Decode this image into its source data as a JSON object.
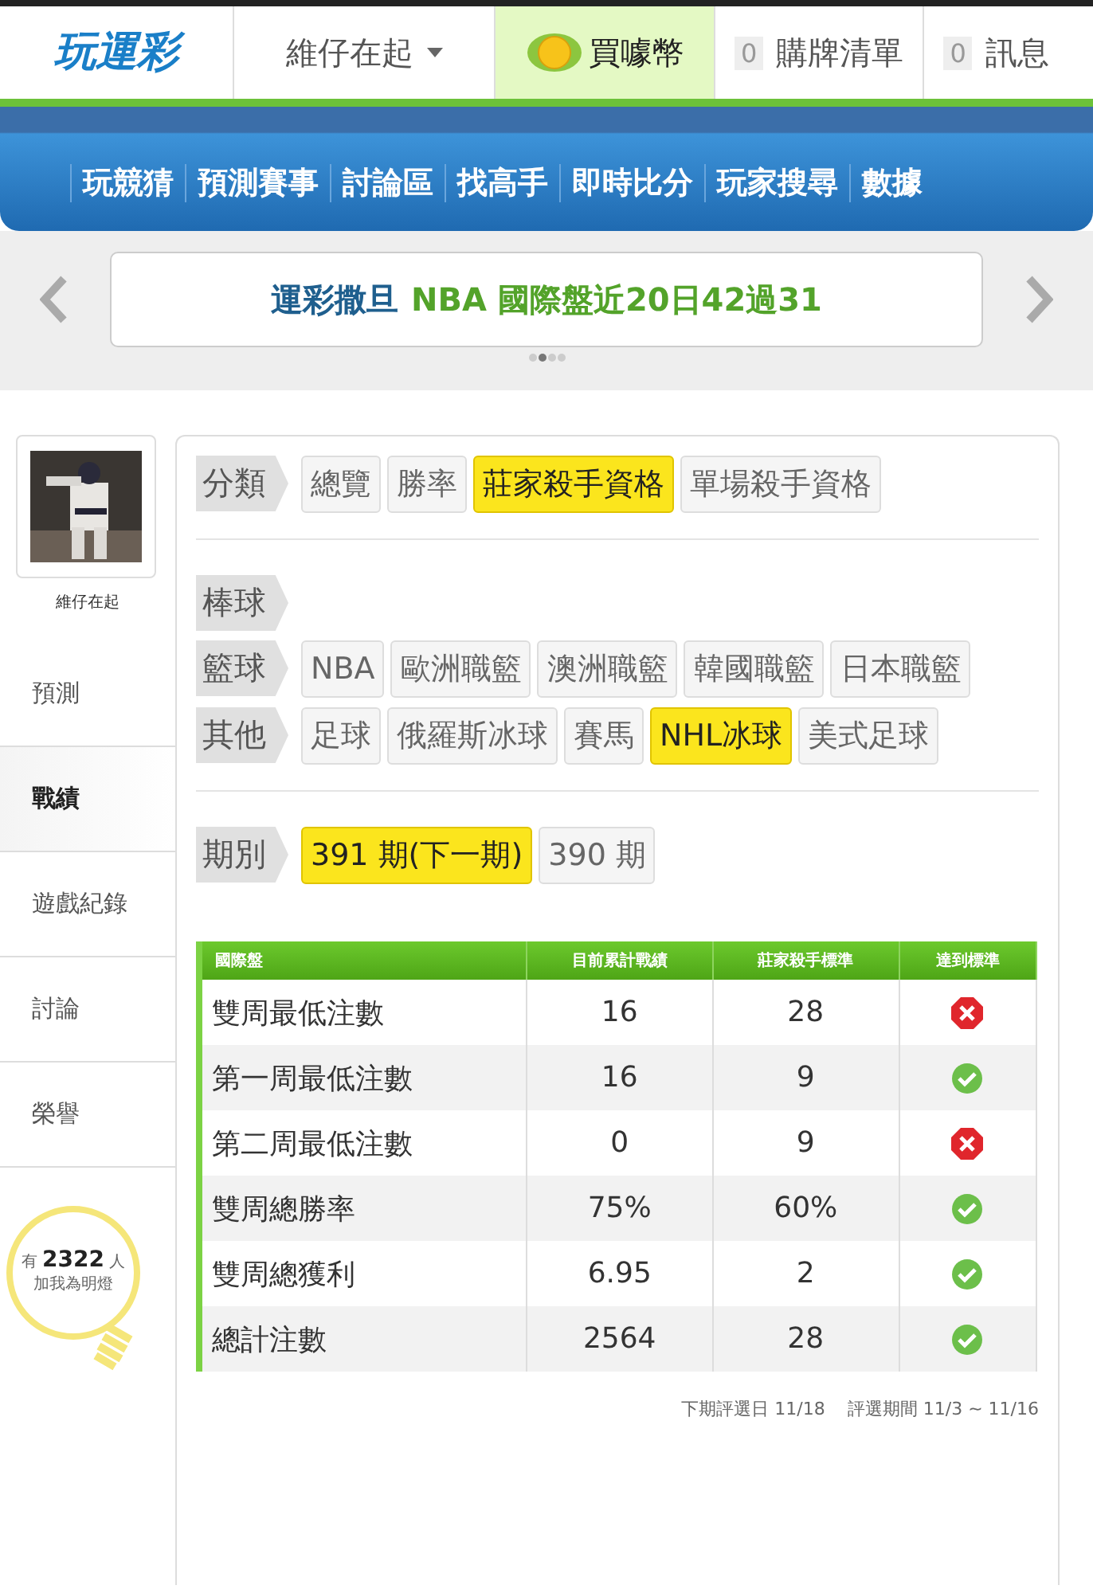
{
  "header": {
    "logo": "玩運彩",
    "user_menu": "維仔在起",
    "buy_coins": "買噱幣",
    "cart": {
      "count": "0",
      "label": "購牌清單"
    },
    "messages": {
      "count": "0",
      "label": "訊息"
    }
  },
  "nav": [
    "玩競猜",
    "預測賽事",
    "討論區",
    "找高手",
    "即時比分",
    "玩家搜尋",
    "數據"
  ],
  "banner": {
    "author": "運彩撒旦",
    "headline": "NBA 國際盤近20日42過31",
    "dots": [
      {
        "selected": false
      },
      {
        "selected": true
      },
      {
        "selected": false
      },
      {
        "selected": false
      }
    ]
  },
  "sidebar": {
    "username": "維仔在起",
    "items": [
      {
        "label": "預測",
        "selected": false
      },
      {
        "label": "戰績",
        "selected": true
      },
      {
        "label": "遊戲紀錄",
        "selected": false
      },
      {
        "label": "討論",
        "selected": false
      },
      {
        "label": "榮譽",
        "selected": false
      }
    ],
    "fans": {
      "prefix": "有",
      "count": "2322",
      "suffix": "人",
      "caption": "加我為明燈"
    }
  },
  "filters": [
    {
      "label": "分類",
      "options": [
        {
          "label": "總覽",
          "selected": false
        },
        {
          "label": "勝率",
          "selected": false
        },
        {
          "label": "莊家殺手資格",
          "selected": true
        },
        {
          "label": "單場殺手資格",
          "selected": false
        }
      ]
    },
    {
      "label": "棒球"
    },
    {
      "label": "籃球",
      "options": [
        {
          "label": "NBA",
          "selected": false
        },
        {
          "label": "歐洲職籃",
          "selected": false
        },
        {
          "label": "澳洲職籃",
          "selected": false
        },
        {
          "label": "韓國職籃",
          "selected": false
        },
        {
          "label": "日本職籃",
          "selected": false
        }
      ]
    },
    {
      "label": "其他",
      "options": [
        {
          "label": "足球",
          "selected": false
        },
        {
          "label": "俄羅斯冰球",
          "selected": false
        },
        {
          "label": "賽馬",
          "selected": false
        },
        {
          "label": "NHL冰球",
          "selected": true
        },
        {
          "label": "美式足球",
          "selected": false
        }
      ]
    },
    {
      "label": "期別",
      "options": [
        {
          "label": "391 期(下一期)",
          "selected": true
        },
        {
          "label": "390 期",
          "selected": false
        }
      ]
    }
  ],
  "table": {
    "columns": [
      "國際盤",
      "目前累計戰績",
      "莊家殺手標準",
      "達到標準"
    ],
    "rows": [
      {
        "name": "雙周最低注數",
        "current": "16",
        "standard": "28",
        "met": false
      },
      {
        "name": "第一周最低注數",
        "current": "16",
        "standard": "9",
        "met": true
      },
      {
        "name": "第二周最低注數",
        "current": "0",
        "standard": "9",
        "met": false
      },
      {
        "name": "雙周總勝率",
        "current": "75%",
        "standard": "60%",
        "met": true
      },
      {
        "name": "雙周總獲利",
        "current": "6.95",
        "standard": "2",
        "met": true
      },
      {
        "name": "總計注數",
        "current": "2564",
        "standard": "28",
        "met": true
      }
    ]
  },
  "footer": {
    "next_date": "下期評選日 11/18",
    "period": "評選期間 11/3 ~ 11/16"
  }
}
